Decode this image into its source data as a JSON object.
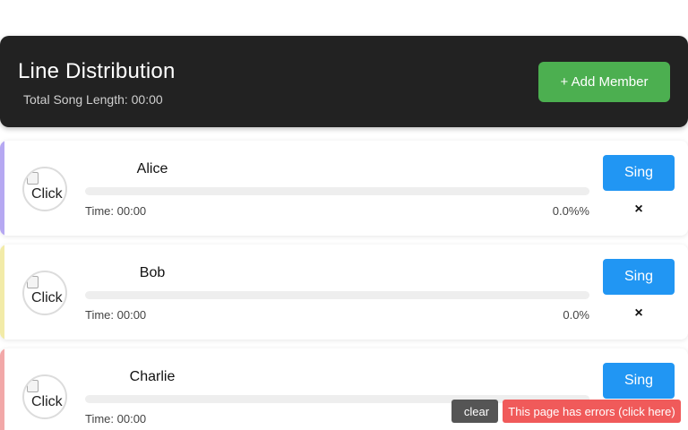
{
  "header": {
    "title": "Line Distribution",
    "total_label": "Total Song Length: 00:00",
    "add_button_label": "+ Add Member"
  },
  "members": [
    {
      "name": "Alice",
      "avatar_alt": "Click",
      "time_label": "Time: 00:00",
      "percent_label": "0.0%%",
      "progress": 0,
      "accent_color": "#b6a8f2",
      "sing_label": "Sing",
      "remove_icon": "×"
    },
    {
      "name": "Bob",
      "avatar_alt": "Click",
      "time_label": "Time: 00:00",
      "percent_label": "0.0%",
      "progress": 0,
      "accent_color": "#f2eba8",
      "sing_label": "Sing",
      "remove_icon": "×"
    },
    {
      "name": "Charlie",
      "avatar_alt": "Click",
      "time_label": "Time: 00:00",
      "percent_label": "",
      "progress": 0,
      "accent_color": "#f2a8a8",
      "sing_label": "Sing",
      "remove_icon": "×"
    }
  ],
  "error_overlay": {
    "clear_icon": "",
    "clear_label": "clear",
    "errors_label": "This page has errors (click here)"
  },
  "colors": {
    "header_bg": "#222222",
    "add_button": "#4caf50",
    "sing_button": "#2196f3",
    "error_bg": "#f05a5a",
    "clear_bg": "#555555"
  }
}
